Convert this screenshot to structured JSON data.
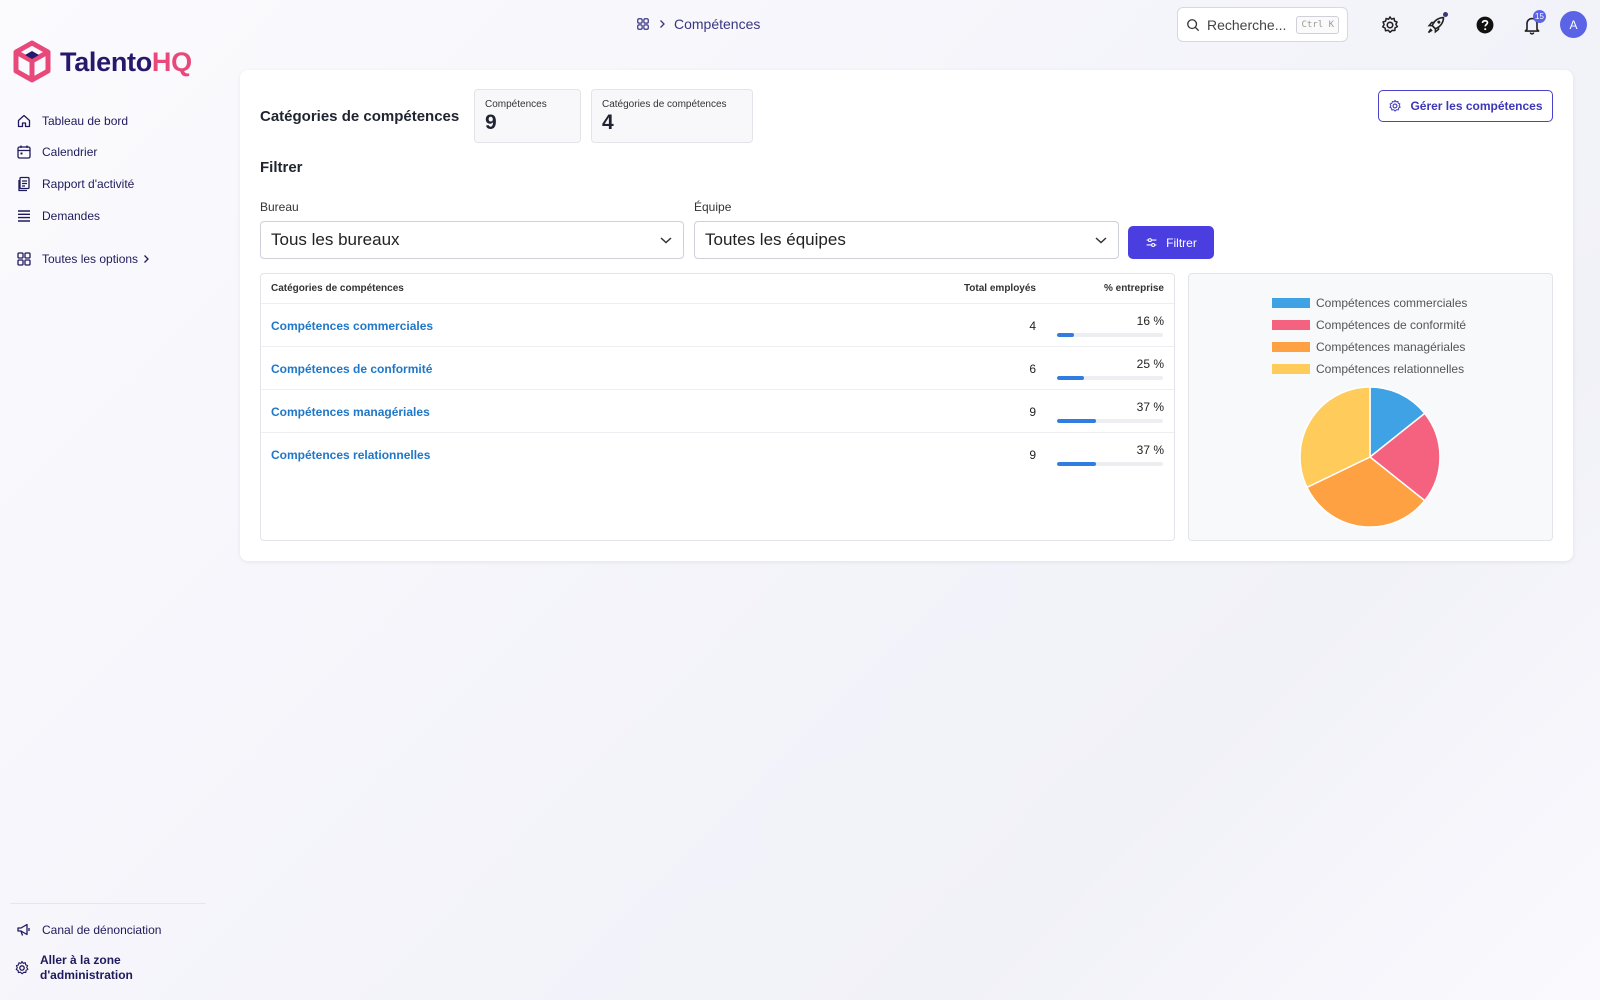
{
  "brand": {
    "name_a": "Talento",
    "name_b": "HQ"
  },
  "sidebar": {
    "items": [
      {
        "label": "Tableau de bord",
        "icon": "home-icon"
      },
      {
        "label": "Calendrier",
        "icon": "calendar-icon"
      },
      {
        "label": "Rapport d'activité",
        "icon": "report-icon"
      },
      {
        "label": "Demandes",
        "icon": "requests-icon"
      }
    ],
    "all_options": "Toutes les options",
    "bottom": [
      {
        "label": "Canal de dénonciation",
        "icon": "megaphone-icon"
      },
      {
        "label": "Aller à la zone d'administration",
        "icon": "gear-icon"
      }
    ]
  },
  "topbar": {
    "breadcrumb": "Compétences",
    "search_placeholder": "Recherche...",
    "search_shortcut": "Ctrl K",
    "notifications_count": "15",
    "avatar_initial": "A"
  },
  "main": {
    "title": "Catégories de compétences",
    "stats": [
      {
        "label": "Compétences",
        "value": "9"
      },
      {
        "label": "Catégories de compétences",
        "value": "4"
      }
    ],
    "manage_button": "Gérer les compétences",
    "filter_title": "Filtrer",
    "filters": {
      "office_label": "Bureau",
      "office_value": "Tous les bureaux",
      "team_label": "Équipe",
      "team_value": "Toutes les équipes",
      "button": "Filtrer"
    },
    "table": {
      "headers": [
        "Catégories de compétences",
        "Total employés",
        "% entreprise"
      ],
      "rows": [
        {
          "category": "Compétences commerciales",
          "total": "4",
          "percent": "16 %",
          "fraction": 0.16
        },
        {
          "category": "Compétences de conformité",
          "total": "6",
          "percent": "25 %",
          "fraction": 0.25
        },
        {
          "category": "Compétences managériales",
          "total": "9",
          "percent": "37 %",
          "fraction": 0.37
        },
        {
          "category": "Compétences relationnelles",
          "total": "9",
          "percent": "37 %",
          "fraction": 0.37
        }
      ]
    }
  },
  "chart_data": {
    "type": "pie",
    "categories": [
      "Compétences commerciales",
      "Compétences de conformité",
      "Compétences managériales",
      "Compétences relationnelles"
    ],
    "values": [
      4,
      6,
      9,
      9
    ],
    "colors": [
      "#3ea2e5",
      "#f5627f",
      "#fea142",
      "#ffcb5a"
    ],
    "legend": "top",
    "title": ""
  }
}
